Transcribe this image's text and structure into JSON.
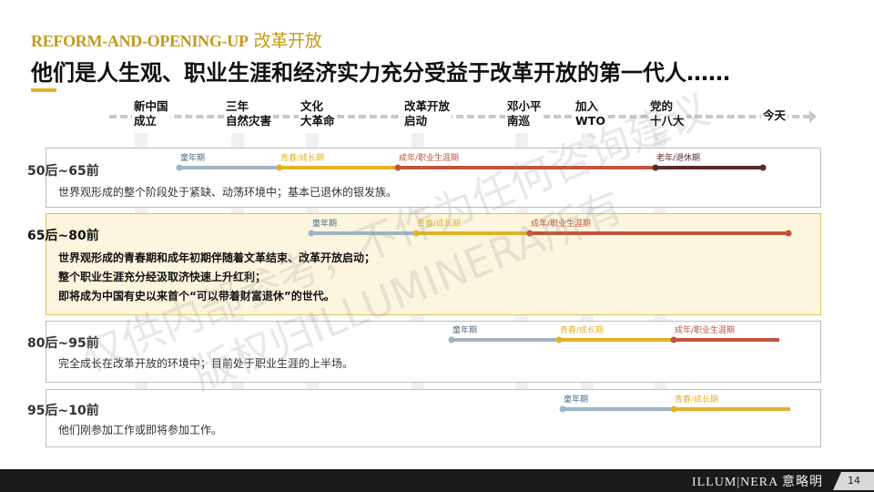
{
  "header": {
    "kicker_en": "REFORM-AND-OPENING-UP",
    "kicker_cn": "改革开放",
    "title": "他们是人生观、职业生涯和经济实力充分受益于改革开放的第一代人……"
  },
  "milestones": [
    "新中国\n成立",
    "三年\n自然灾害",
    "文化\n大革命",
    "改革开放\n启动",
    "邓小平\n南巡",
    "加入\nWTO",
    "党的\n十八大",
    "今天"
  ],
  "phase_colors": {
    "童年期": "#9fb5c5",
    "青春/成长期": "#e3b229",
    "成年/职业生涯期": "#c0553f",
    "老年/退休期": "#5a2a2a"
  },
  "generations": [
    {
      "label": "50后~65前",
      "description": [
        "世界观形成的整个阶段处于紧缺、动荡环境中；基本已退休的银发族。"
      ],
      "phases": [
        {
          "name": "童年期",
          "label": "童年期"
        },
        {
          "name": "青春/成长期",
          "label": "青春/成长期"
        },
        {
          "name": "成年/职业生涯期",
          "label": "成年/职业生涯期"
        },
        {
          "name": "老年/退休期",
          "label": "老年/退休期"
        }
      ]
    },
    {
      "label": "65后~80前",
      "highlight": true,
      "description": [
        "世界观形成的青春期和成年初期伴随着文革结束、改革开放启动；",
        "整个职业生涯充分经汲取济快速上升红利；",
        "即将成为中国有史以来首个“可以带着财富退休”的世代。"
      ],
      "phases": [
        {
          "name": "童年期",
          "label": "童年期"
        },
        {
          "name": "青春/成长期",
          "label": "青春/成长期"
        },
        {
          "name": "成年/职业生涯期",
          "label": "成年/职业生涯期"
        }
      ]
    },
    {
      "label": "80后~95前",
      "description": [
        "完全成长在改革开放的环境中；目前处于职业生涯的上半场。"
      ],
      "phases": [
        {
          "name": "童年期",
          "label": "童年期"
        },
        {
          "name": "青春/成长期",
          "label": "青春/成长期"
        },
        {
          "name": "成年/职业生涯期",
          "label": "成年/职业生涯期"
        }
      ]
    },
    {
      "label": "95后~10前",
      "description": [
        "他们刚参加工作或即将参加工作。"
      ],
      "phases": [
        {
          "name": "童年期",
          "label": "童年期"
        },
        {
          "name": "青春/成长期",
          "label": "青春/成长期"
        }
      ]
    }
  ],
  "watermark": [
    "仅供内部参考，不作为任何咨询建议",
    "版权归ILLUMINERA所有"
  ],
  "footer": {
    "brand": "ILLUM|NERA 意略明",
    "page": "14"
  }
}
